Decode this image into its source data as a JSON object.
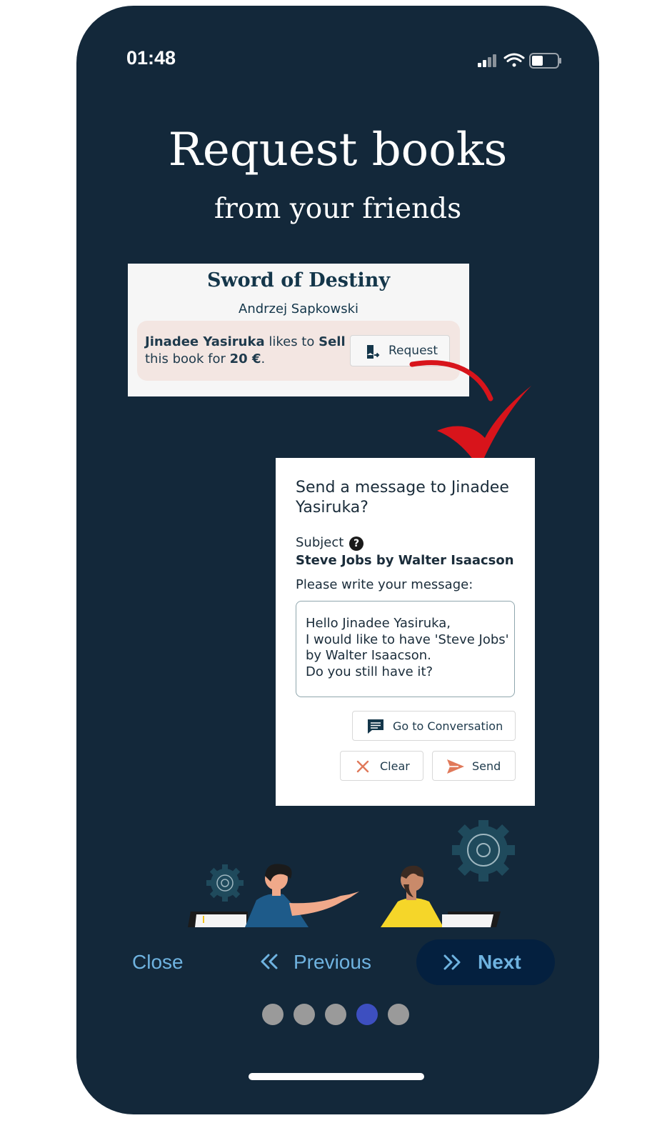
{
  "status_bar": {
    "time": "01:48"
  },
  "heading": {
    "title": "Request books",
    "subtitle": "from your friends"
  },
  "book_card": {
    "title": "Sword of Destiny",
    "author": "Andrzej Sapkowski",
    "seller_name": "Jinadee Yasiruka",
    "likes_to": " likes to ",
    "action": "Sell",
    "this_book_for": "this book for ",
    "price": "20 €",
    "period": ".",
    "request_label": "Request"
  },
  "dialog": {
    "title": "Send a message to Jinadee Yasiruka?",
    "subject_label": "Subject",
    "help_icon_glyph": "?",
    "subject_value": "Steve Jobs by Walter Isaacson",
    "message_prompt": "Please write your message:",
    "message_text": "Hello Jinadee Yasiruka,\nI would like to have 'Steve Jobs' by Walter Isaacson.\nDo you still have it?",
    "go_to_conversation": "Go to Conversation",
    "clear": "Clear",
    "send": "Send"
  },
  "navigation": {
    "close": "Close",
    "previous": "Previous",
    "next": "Next",
    "page_count": 5,
    "active_page": 4
  },
  "colors": {
    "background": "#13283a",
    "nav_text": "#6fb3e0",
    "next_button": "#04203f",
    "active_dot": "#3d4fc0",
    "arrow": "#d8141b",
    "accent_orange": "#e0795a"
  }
}
